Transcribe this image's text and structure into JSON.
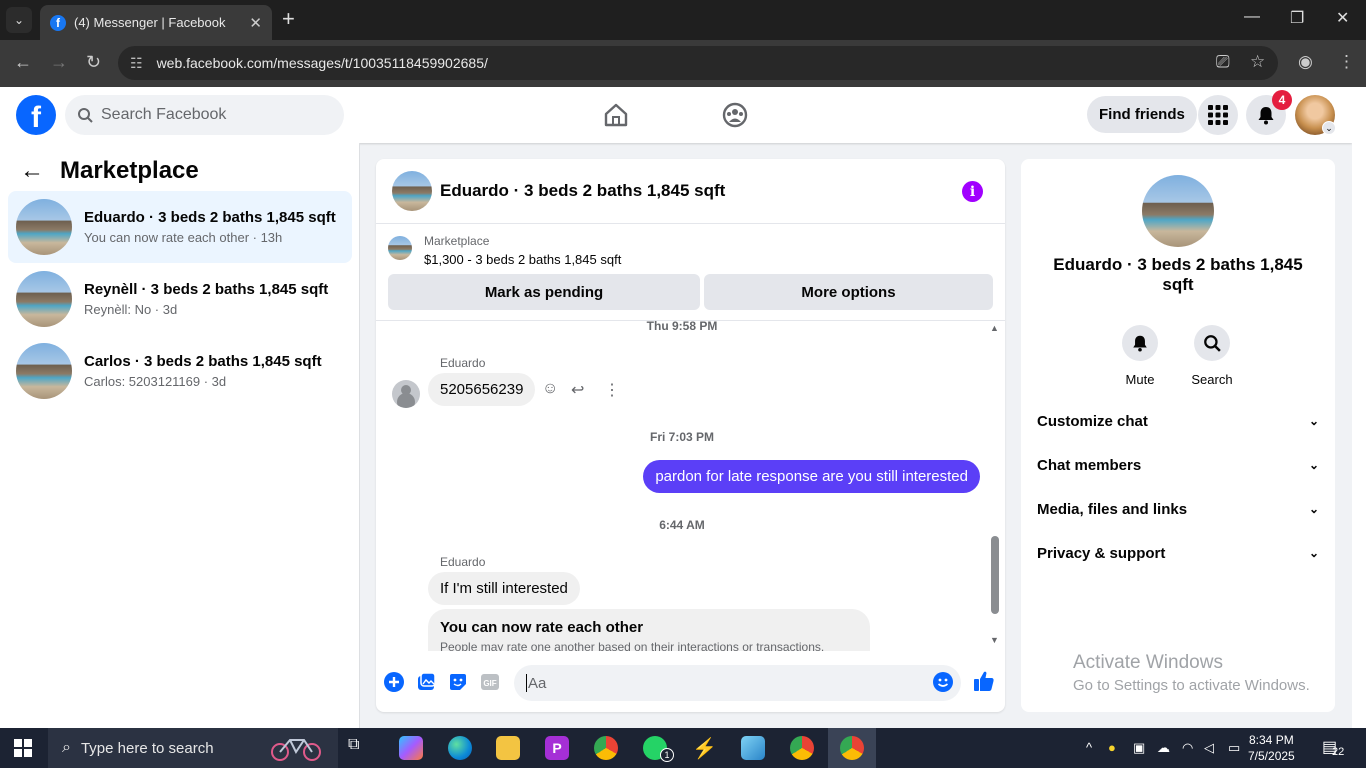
{
  "browser": {
    "tab_title": "(4) Messenger | Facebook",
    "url": "web.facebook.com/messages/t/10035118459902685/"
  },
  "fb_header": {
    "search_placeholder": "Search Facebook",
    "find_friends": "Find friends",
    "notification_count": "4"
  },
  "left_panel": {
    "title": "Marketplace",
    "conversations": [
      {
        "name": "Eduardo · 3 beds 2 baths 1,845 sqft",
        "preview": "You can now rate each other · 13h"
      },
      {
        "name": "Reynèll · 3 beds 2 baths 1,845 sqft",
        "preview": "Reynèll: No · 3d"
      },
      {
        "name": "Carlos · 3 beds 2 baths 1,845 sqft",
        "preview": "Carlos: 5203121169 · 3d"
      }
    ]
  },
  "chat": {
    "title": "Eduardo · 3 beds 2 baths 1,845 sqft",
    "listing_source": "Marketplace",
    "listing_desc": "$1,300 - 3 beds 2 baths 1,845 sqft",
    "mark_pending": "Mark as pending",
    "more_options": "More options",
    "messages": {
      "ts1": "Thu 9:58 PM",
      "sender1": "Eduardo",
      "msg1": "5205656239",
      "ts2": "Fri 7:03 PM",
      "msg2": "pardon for late response are you still interested",
      "ts3": "6:44 AM",
      "sender2": "Eduardo",
      "msg3": "If I'm still interested",
      "rate_title": "You can now rate each other",
      "rate_desc": "People may rate one another based on their interactions or transactions."
    },
    "composer_placeholder": "Aa",
    "gif_label": "GIF"
  },
  "right_panel": {
    "name": "Eduardo · 3 beds 2 baths 1,845 sqft",
    "mute": "Mute",
    "search": "Search",
    "sections": [
      "Customize chat",
      "Chat members",
      "Media, files and links",
      "Privacy & support"
    ]
  },
  "watermark": {
    "line1": "Activate Windows",
    "line2": "Go to Settings to activate Windows."
  },
  "taskbar": {
    "search_placeholder": "Type here to search",
    "time": "8:34 PM",
    "date": "7/5/2025",
    "notifications": "22",
    "whatsapp_badge": "1"
  },
  "colors": {
    "fb_blue": "#0866ff",
    "outgoing_bubble": "#5b3ff7",
    "info_icon": "#a100ff",
    "badge_red": "#e41e3f"
  }
}
